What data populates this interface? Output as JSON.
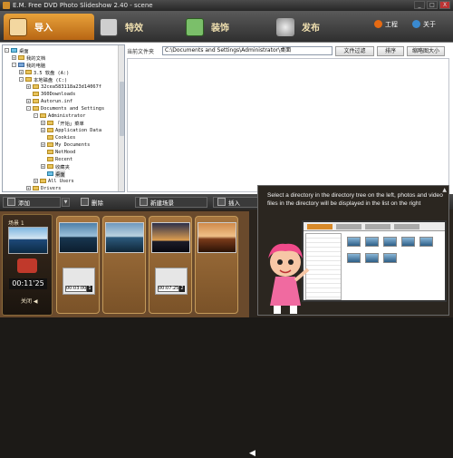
{
  "window": {
    "title": "E.M. Free DVD Photo Slideshow 2.40 - scene",
    "buttons": [
      "_",
      "□",
      "X"
    ]
  },
  "tabs": [
    {
      "label": "导入",
      "active": true,
      "icon": "import-icon"
    },
    {
      "label": "特效",
      "active": false,
      "icon": "effects-icon"
    },
    {
      "label": "装饰",
      "active": false,
      "icon": "decor-icon"
    },
    {
      "label": "发布",
      "active": false,
      "icon": "disc-icon"
    }
  ],
  "top_right": {
    "project_label": "工程",
    "about_label": "关于"
  },
  "tree": [
    {
      "label": "桌面",
      "depth": 0,
      "icon": "desktop-icon",
      "exp": "-"
    },
    {
      "label": "我的文档",
      "depth": 1,
      "icon": "folder-icon",
      "exp": "+"
    },
    {
      "label": "我的电脑",
      "depth": 1,
      "icon": "computer-icon",
      "exp": "-"
    },
    {
      "label": "3.5 软盘 (A:)",
      "depth": 2,
      "icon": "floppy-icon",
      "exp": "+"
    },
    {
      "label": "本地磁盘 (C:)",
      "depth": 2,
      "icon": "drive-icon",
      "exp": "-"
    },
    {
      "label": "32cea583118a23d14067f",
      "depth": 3,
      "icon": "folder-icon",
      "exp": "+"
    },
    {
      "label": "360Downloads",
      "depth": 3,
      "icon": "folder-icon",
      "exp": ""
    },
    {
      "label": "Autorun.inf",
      "depth": 3,
      "icon": "folder-icon",
      "exp": "+"
    },
    {
      "label": "Documents and Settings",
      "depth": 3,
      "icon": "folder-icon",
      "exp": "-"
    },
    {
      "label": "Administrator",
      "depth": 4,
      "icon": "folder-icon",
      "exp": "-"
    },
    {
      "label": "「开始」菜单",
      "depth": 5,
      "icon": "folder-icon",
      "exp": "+"
    },
    {
      "label": "Application Data",
      "depth": 5,
      "icon": "folder-icon",
      "exp": "+"
    },
    {
      "label": "Cookies",
      "depth": 5,
      "icon": "folder-icon",
      "exp": ""
    },
    {
      "label": "My Documents",
      "depth": 5,
      "icon": "folder-icon",
      "exp": "+"
    },
    {
      "label": "NetHood",
      "depth": 5,
      "icon": "folder-icon",
      "exp": ""
    },
    {
      "label": "Recent",
      "depth": 5,
      "icon": "folder-icon",
      "exp": ""
    },
    {
      "label": "收藏夹",
      "depth": 5,
      "icon": "folder-icon",
      "exp": "+"
    },
    {
      "label": "桌面",
      "depth": 5,
      "icon": "desktop-icon",
      "exp": "",
      "selected": true
    },
    {
      "label": "All Users",
      "depth": 4,
      "icon": "folder-icon",
      "exp": "+"
    },
    {
      "label": "Drivers",
      "depth": 3,
      "icon": "folder-icon",
      "exp": "+"
    }
  ],
  "pathbar": {
    "label": "当前文件夹",
    "value": "C:\\Documents and Settings\\Administrator\\桌面",
    "filter_label": "文件过滤",
    "sort_label": "排序",
    "thumbsize_label": "缩略图大小"
  },
  "bottom_toolbar": {
    "add_label": "添加",
    "delete_label": "删除",
    "new_scene_label": "新建场景",
    "insert_label": "插入"
  },
  "scene": {
    "label": "场景 1",
    "duration": "00:11'25",
    "close_label": "关闭 ◀"
  },
  "transitions": [
    {
      "time": "00:03.00",
      "num": "1"
    },
    {
      "time": "00:07.25",
      "num": "2"
    }
  ],
  "hint": {
    "text": "Select a directory in the directory tree on the left, photos and video files in the directory will be displayed in the list on the right",
    "mini_tabs": [
      "Import",
      "Transition",
      "Mattering",
      "Publish"
    ]
  }
}
